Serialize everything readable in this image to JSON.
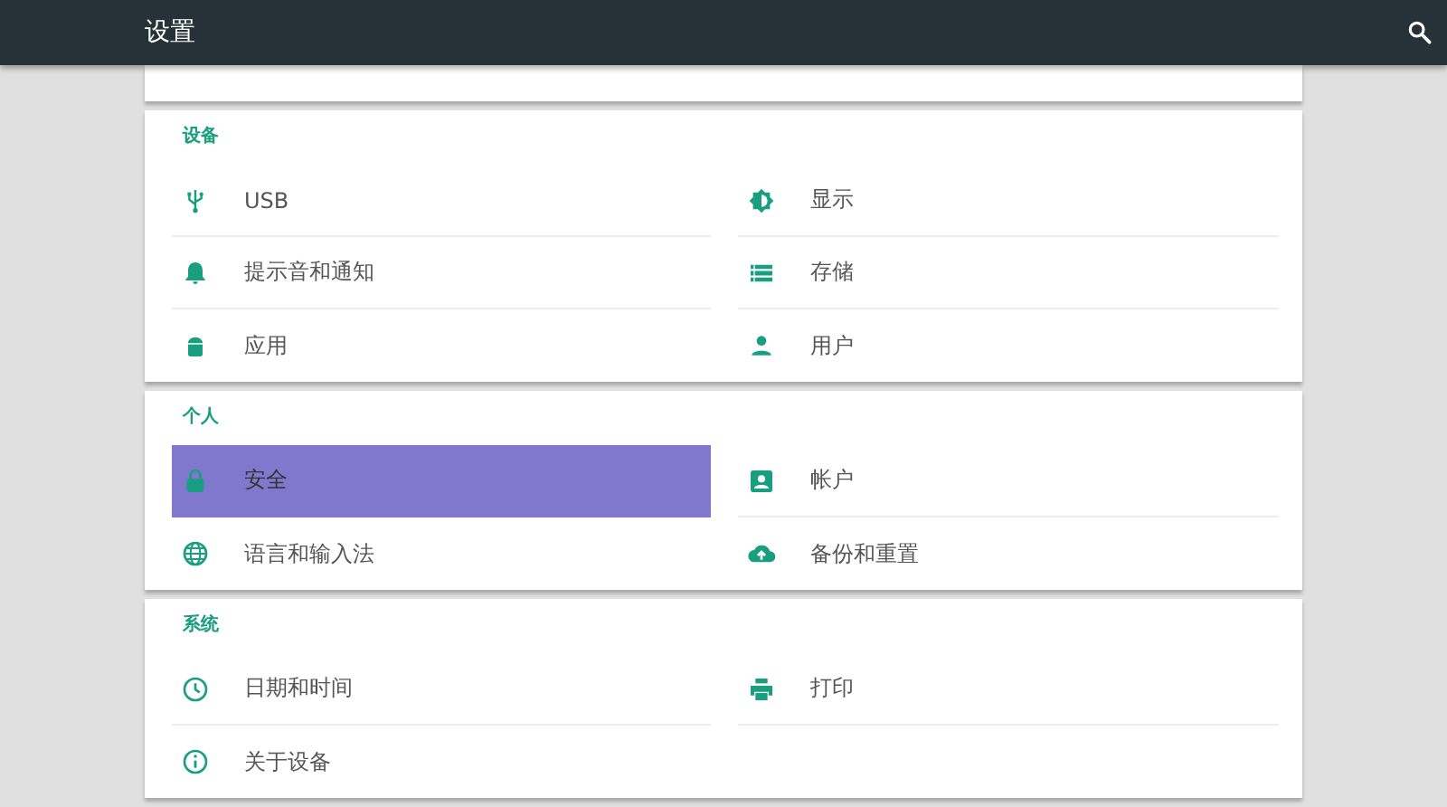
{
  "app_bar": {
    "title": "设置"
  },
  "sections": [
    {
      "title": "设备",
      "items": [
        {
          "label": "USB",
          "kind": "usb",
          "selected": false
        },
        {
          "label": "显示",
          "kind": "brightness",
          "selected": false
        },
        {
          "label": "提示音和通知",
          "kind": "bell",
          "selected": false
        },
        {
          "label": "存储",
          "kind": "storage",
          "selected": false
        },
        {
          "label": "应用",
          "kind": "android",
          "selected": false
        },
        {
          "label": "用户",
          "kind": "person",
          "selected": false
        }
      ]
    },
    {
      "title": "个人",
      "items": [
        {
          "label": "安全",
          "kind": "lock",
          "selected": true
        },
        {
          "label": "帐户",
          "kind": "account",
          "selected": false
        },
        {
          "label": "语言和输入法",
          "kind": "globe",
          "selected": false
        },
        {
          "label": "备份和重置",
          "kind": "cloud",
          "selected": false
        }
      ]
    },
    {
      "title": "系统",
      "items": [
        {
          "label": "日期和时间",
          "kind": "clock",
          "selected": false
        },
        {
          "label": "打印",
          "kind": "print",
          "selected": false
        },
        {
          "label": "关于设备",
          "kind": "info",
          "selected": false
        }
      ]
    }
  ]
}
